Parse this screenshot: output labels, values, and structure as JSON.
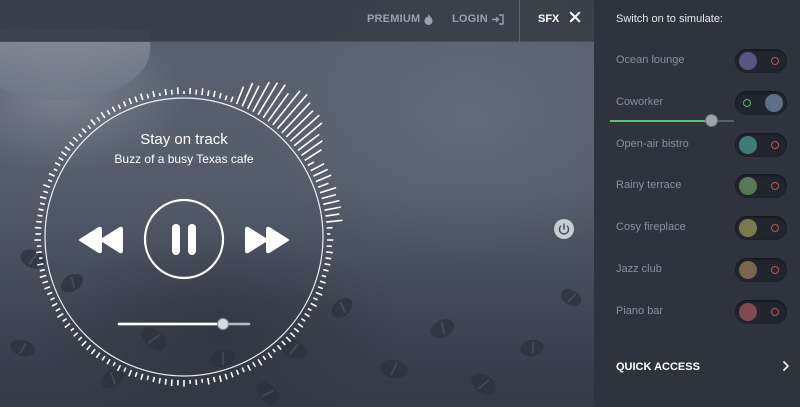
{
  "nav": {
    "premium_label": "PREMIUM",
    "login_label": "LOGIN",
    "sfx_label": "SFX"
  },
  "player": {
    "title": "Stay on track",
    "subtitle": "Buzz of a busy Texas cafe",
    "volume": 0.8,
    "icons": [
      "rewind-icon",
      "pause-icon",
      "fast-forward-icon",
      "power-icon"
    ]
  },
  "panel": {
    "title": "Switch on to simulate:",
    "sounds": [
      {
        "label": "Ocean lounge",
        "on": false,
        "color": "#5a5580"
      },
      {
        "label": "Coworker",
        "on": true,
        "color": "#5e7088",
        "volume": 0.82
      },
      {
        "label": "Open-air bistro",
        "on": false,
        "color": "#3f7a78"
      },
      {
        "label": "Rainy terrace",
        "on": false,
        "color": "#577a55"
      },
      {
        "label": "Cosy fireplace",
        "on": false,
        "color": "#7a7a4e"
      },
      {
        "label": "Jazz club",
        "on": false,
        "color": "#7a6550"
      },
      {
        "label": "Piano bar",
        "on": false,
        "color": "#7f4a52"
      }
    ],
    "quick_access_label": "QUICK ACCESS"
  },
  "colors": {
    "accent_green": "#5cc46a",
    "off_ring": "#c75050",
    "on_ring": "#4fb873",
    "panel_bg": "#2e333d"
  }
}
